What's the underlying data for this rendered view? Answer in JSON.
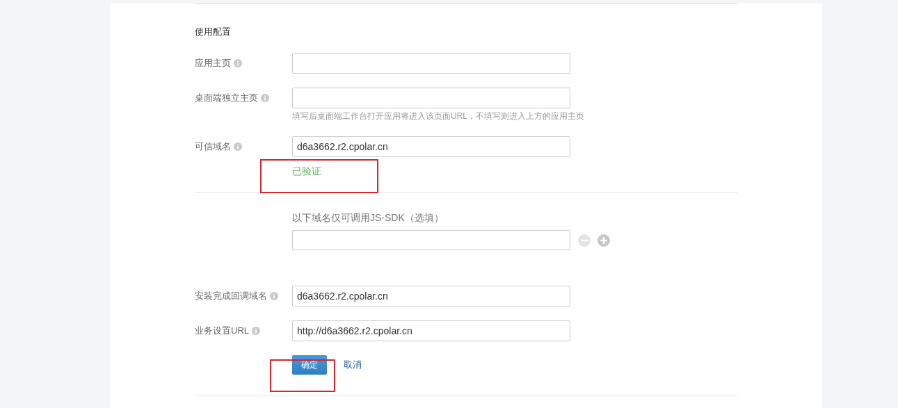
{
  "section": {
    "title": "使用配置"
  },
  "fields": [
    {
      "label": "应用主页",
      "info": true
    },
    {
      "label": "桌面端独立主页",
      "info": true,
      "hint": "填写后桌面端工作台打开应用将进入该页面URL，不填写则进入上方的应用主页"
    },
    {
      "label": "可信域名",
      "info": true,
      "value": "d6a3662.r2.cpolar.cn",
      "status": "已验证"
    }
  ],
  "js_sdk": {
    "title": "以下域名仅可调用JS-SDK（选填）",
    "remove_disabled": true
  },
  "more_fields": [
    {
      "label": "安装完成回调域名",
      "info": true,
      "value": "d6a3662.r2.cpolar.cn"
    },
    {
      "label": "业务设置URL",
      "info": true,
      "value": "http://d6a3662.r2.cpolar.cn"
    }
  ],
  "buttons": [
    {
      "kind": "primary",
      "label": "确定"
    },
    {
      "kind": "link",
      "label": "取消"
    }
  ]
}
